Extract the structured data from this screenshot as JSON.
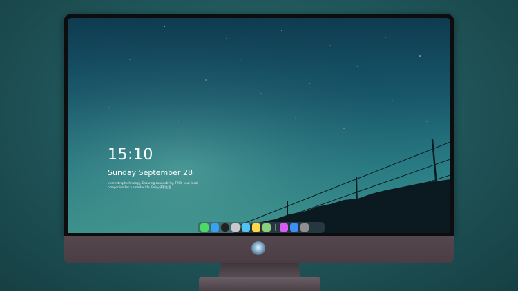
{
  "lock_screen": {
    "time": "15:10",
    "date": "Sunday September 28",
    "tagline": "Interesting technology, Ensuring connectivity, FMD, your ideal companion For a smarter life, Enjoy精彩生活"
  },
  "dock": {
    "apps": [
      {
        "name": "messages-icon",
        "color": "#4cd964"
      },
      {
        "name": "mail-icon",
        "color": "#3aa0f0"
      },
      {
        "name": "clock-icon",
        "color": "#222222"
      },
      {
        "name": "finder-icon",
        "color": "#c7c7cc"
      },
      {
        "name": "video-icon",
        "color": "#54c3f1"
      },
      {
        "name": "notes-icon",
        "color": "#ffd54a"
      },
      {
        "name": "photos-icon",
        "color": "#8ccf7e"
      }
    ],
    "apps_right": [
      {
        "name": "music-icon",
        "color": "#d65cf4"
      },
      {
        "name": "app-store-icon",
        "color": "#3e8ef7"
      },
      {
        "name": "camera-icon",
        "color": "#8e8e93"
      }
    ]
  }
}
